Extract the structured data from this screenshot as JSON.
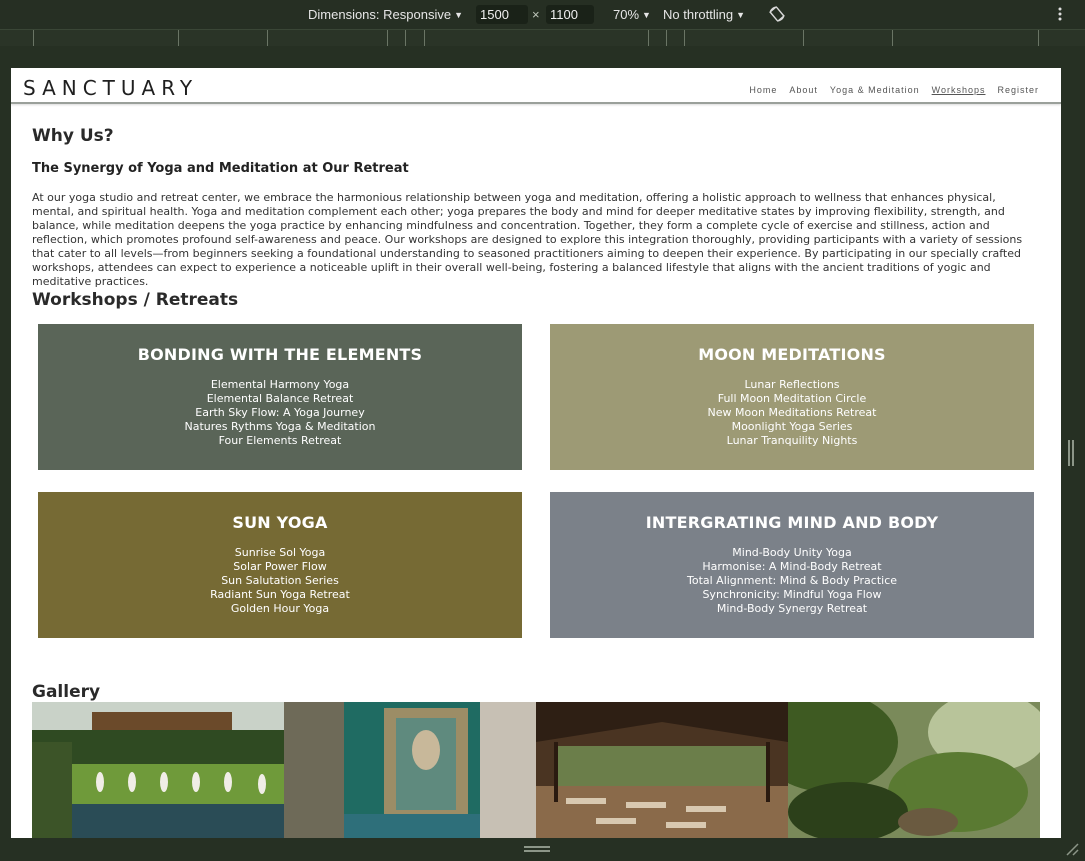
{
  "devtools": {
    "dimensions_label": "Dimensions: Responsive",
    "width": "1500",
    "times": "×",
    "height": "1100",
    "zoom": "70%",
    "throttling": "No throttling"
  },
  "site": {
    "logo": "SANCTUARY",
    "nav": [
      "Home",
      "About",
      "Yoga & Meditation",
      "Workshops",
      "Register"
    ],
    "active_nav": "Workshops"
  },
  "why": {
    "title": "Why Us?",
    "subtitle": "The Synergy of Yoga and Meditation at Our Retreat",
    "body": "At our yoga studio and retreat center, we embrace the harmonious relationship between yoga and meditation, offering a holistic approach to wellness that enhances physical, mental, and spiritual health. Yoga and meditation complement each other; yoga prepares the body and mind for deeper meditative states by improving flexibility, strength, and balance, while meditation deepens the yoga practice by enhancing mindfulness and concentration. Together, they form a complete cycle of exercise and stillness, action and reflection, which promotes profound self-awareness and peace. Our workshops are designed to explore this integration thoroughly, providing participants with a variety of sessions that cater to all levels—from beginners seeking a foundational understanding to seasoned practitioners aiming to deepen their experience. By participating in our specially crafted workshops, attendees can expect to experience a noticeable uplift in their overall well-being, fostering a balanced lifestyle that aligns with the ancient traditions of yogic and meditative practices."
  },
  "workshops": {
    "title": "Workshops / Retreats",
    "cards": [
      {
        "title": "BONDING WITH THE ELEMENTS",
        "color": "#5a6558",
        "items": [
          "Elemental Harmony Yoga",
          "Elemental Balance Retreat",
          "Earth Sky Flow: A Yoga Journey",
          "Natures Rythms Yoga & Meditation",
          "Four Elements Retreat"
        ]
      },
      {
        "title": "MOON MEDITATIONS",
        "color": "#9d9a75",
        "items": [
          "Lunar Reflections",
          "Full Moon Meditation Circle",
          "New Moon Meditations Retreat",
          "Moonlight Yoga Series",
          "Lunar Tranquility Nights"
        ]
      },
      {
        "title": "SUN YOGA",
        "color": "#766a34",
        "items": [
          "Sunrise Sol Yoga",
          "Solar Power Flow",
          "Sun Salutation Series",
          "Radiant Sun Yoga Retreat",
          "Golden Hour Yoga"
        ]
      },
      {
        "title": "INTERGRATING MIND AND BODY",
        "color": "#7b8189",
        "items": [
          "Mind-Body Unity Yoga",
          "Harmonise: A Mind-Body Retreat",
          "Total Alignment: Mind & Body Practice",
          "Synchronicity: Mindful Yoga Flow",
          "Mind-Body Synergy Retreat"
        ]
      }
    ]
  },
  "gallery": {
    "title": "Gallery",
    "photos": [
      "garden-yoga-photo",
      "temple-statue-photo",
      "yoga-pavilion-photo",
      "jungle-foliage-photo"
    ]
  }
}
